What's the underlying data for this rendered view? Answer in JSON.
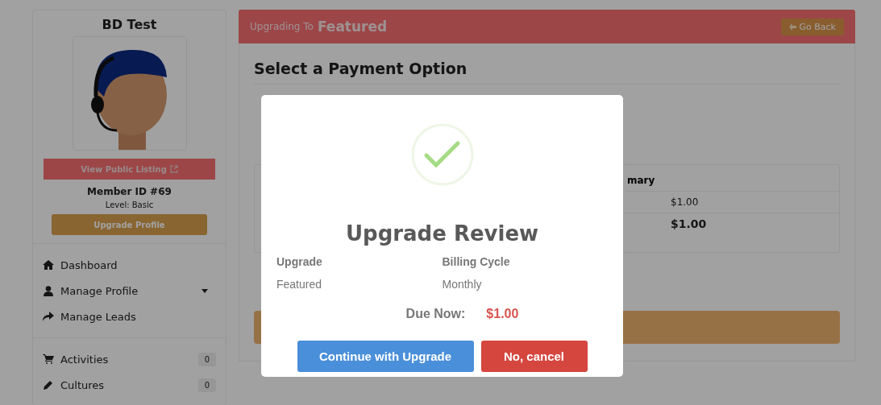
{
  "sidebar": {
    "name": "BD Test",
    "view_listing": "View Public Listing",
    "member_id": "Member ID #69",
    "level_text": "Level: Basic",
    "upgrade_button": "Upgrade Profile",
    "nav": [
      {
        "kind": "home",
        "label": "Dashboard",
        "expandable": false
      },
      {
        "kind": "user",
        "label": "Manage Profile",
        "expandable": true
      },
      {
        "kind": "share",
        "label": "Manage Leads",
        "expandable": false
      }
    ],
    "counters": [
      {
        "kind": "cart",
        "label": "Activities",
        "count": "0"
      },
      {
        "kind": "pencil",
        "label": "Cultures",
        "count": "0"
      }
    ]
  },
  "header": {
    "prefix": "Upgrading To",
    "plan": "Featured",
    "back_button": "Go Back"
  },
  "panel": {
    "heading": "Select a Payment Option",
    "summary_title": "mary",
    "summary_rows": [
      {
        "value": "$1.00",
        "bold": false
      },
      {
        "value": "$1.00",
        "bold": true
      }
    ]
  },
  "modal": {
    "title": "Upgrade Review",
    "columns": [
      {
        "label": "Upgrade",
        "value": "Featured"
      },
      {
        "label": "Billing Cycle",
        "value": "Monthly"
      }
    ],
    "due_label": "Due Now:",
    "due_amount": "$1.00",
    "confirm_button": "Continue with Upgrade",
    "cancel_button": "No, cancel"
  }
}
